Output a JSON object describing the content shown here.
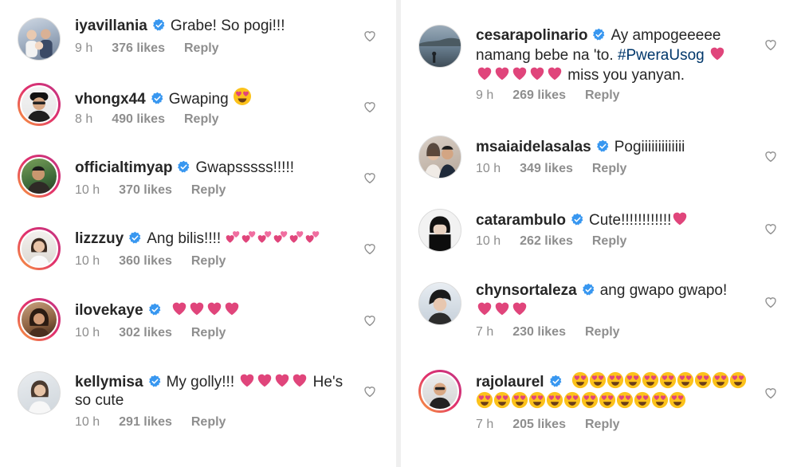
{
  "left_comments": [
    {
      "username": "iyavillania",
      "text": "Grabe! So pogi!!!",
      "time": "9 h",
      "likes": "376 likes",
      "reply": "Reply"
    },
    {
      "username": "vhongx44",
      "text": "Gwaping",
      "time": "8 h",
      "likes": "490 likes",
      "reply": "Reply"
    },
    {
      "username": "officialtimyap",
      "text": "Gwapsssss!!!!!",
      "time": "10 h",
      "likes": "370 likes",
      "reply": "Reply"
    },
    {
      "username": "lizzzuy",
      "text": "Ang bilis!!!!",
      "time": "10 h",
      "likes": "360 likes",
      "reply": "Reply"
    },
    {
      "username": "ilovekaye",
      "text": "",
      "time": "10 h",
      "likes": "302 likes",
      "reply": "Reply"
    },
    {
      "username": "kellymisa",
      "text_a": "My golly!!!",
      "text_b": "He's so cute",
      "time": "10 h",
      "likes": "291 likes",
      "reply": "Reply"
    }
  ],
  "right_comments": [
    {
      "username": "cesarapolinario",
      "text_a": "Ay ampogeeeee namang bebe na 'to.",
      "hashtag": "#PweraUsog",
      "text_b": "miss you yanyan.",
      "time": "9 h",
      "likes": "269 likes",
      "reply": "Reply"
    },
    {
      "username": "msaiaidelasalas",
      "text": "Pogiiiiiiiiiiiii",
      "time": "10 h",
      "likes": "349 likes",
      "reply": "Reply"
    },
    {
      "username": "catarambulo",
      "text": "Cute!!!!!!!!!!!!",
      "time": "10 h",
      "likes": "262 likes",
      "reply": "Reply"
    },
    {
      "username": "chynsortaleza",
      "text": "ang gwapo gwapo!",
      "time": "7 h",
      "likes": "230 likes",
      "reply": "Reply"
    },
    {
      "username": "rajolaurel",
      "text": "",
      "time": "7 h",
      "likes": "205 likes",
      "reply": "Reply"
    }
  ],
  "colors": {
    "verified": "#3897f0",
    "heart": "#e0457b",
    "meta": "#8e8e8e",
    "text": "#262626",
    "hashtag": "#00376b"
  },
  "icons": {
    "verified": "verified-badge-icon",
    "like": "heart-outline-icon",
    "emoji_heart": "red-heart-emoji",
    "emoji_heart_eyes": "smiling-face-with-heart-eyes-emoji",
    "emoji_two_hearts": "two-hearts-emoji"
  }
}
